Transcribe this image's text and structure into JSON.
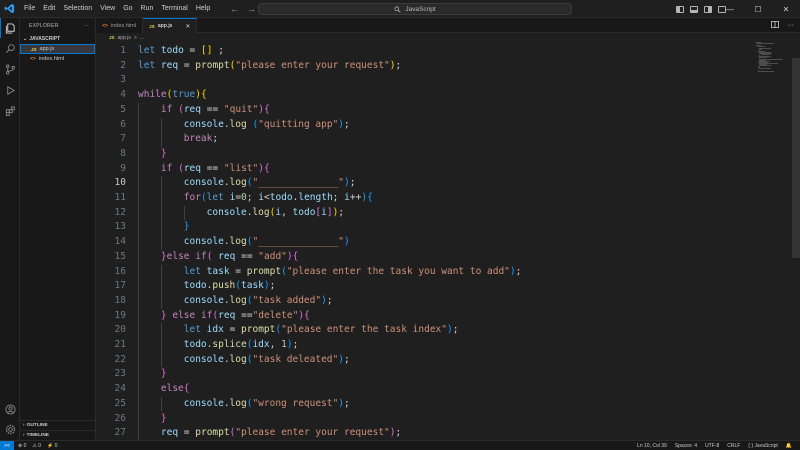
{
  "menu": [
    "File",
    "Edit",
    "Selection",
    "View",
    "Go",
    "Run",
    "Terminal",
    "Help"
  ],
  "search": {
    "text": "JavaScript"
  },
  "window": {
    "minimize": "—",
    "maximize": "☐",
    "close": "✕"
  },
  "sidebar": {
    "title": "EXPLORER",
    "more": "···",
    "folder": "JAVASCRIPT",
    "files": [
      {
        "badge": "JS",
        "name": "app.js"
      },
      {
        "badge": "<>",
        "name": "index.html"
      }
    ],
    "outline": "OUTLINE",
    "timeline": "TIMELINE"
  },
  "tabs": [
    {
      "badge": "<>",
      "name": "index.html"
    },
    {
      "badge": "JS",
      "name": "app.js",
      "close": "✕"
    }
  ],
  "breadcrumbs": {
    "badge": "JS",
    "file": "app.js",
    "sep": ">",
    "more": "..."
  },
  "editor": {
    "current_line": 10,
    "code": [
      "let todo = [] ;",
      "let req = prompt(\"please enter your request\");",
      "",
      "while(true){",
      "    if (req == \"quit\"){",
      "        console.log (\"quitting app\");",
      "        break;",
      "    }",
      "    if (req == \"list\"){",
      "        console.log(\"______________\");",
      "        for(let i=0; i<todo.length; i++){",
      "            console.log(i, todo[i]);",
      "        }",
      "        console.log(\"______________\")",
      "    }else if( req == \"add\"){",
      "        let task = prompt(\"please enter the task you want to add\");",
      "        todo.push(task);",
      "        console.log(\"task added\");",
      "    } else if(req ==\"delete\"){",
      "        let idx = prompt(\"please enter the task index\");",
      "        todo.splice(idx, 1);",
      "        console.log(\"task deleated\");",
      "    }",
      "    else{",
      "        console.log(\"wrong request\");",
      "    }",
      "    req = prompt(\"please enter your request\");"
    ]
  },
  "status": {
    "remote": "><",
    "errors": "⊗ 0",
    "warnings": "⚠ 0",
    "ports": "⚡ 0",
    "position": "Ln 10, Col 39",
    "spaces": "Spaces: 4",
    "encoding": "UTF-8",
    "eol": "CRLF",
    "language": "{ } JavaScript",
    "bell": "🔔"
  }
}
